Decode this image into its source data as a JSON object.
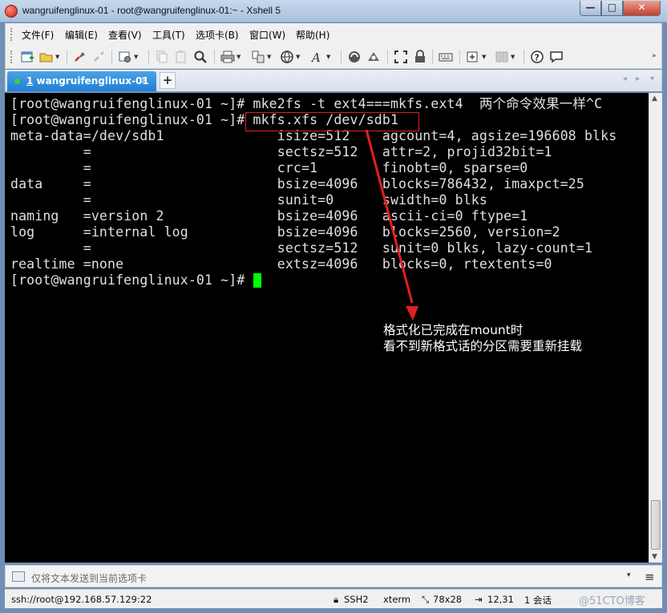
{
  "window": {
    "title": "wangruifenglinux-01 - root@wangruifenglinux-01:~ - Xshell 5",
    "min_glyph": "—",
    "max_glyph": "□",
    "close_glyph": "✕"
  },
  "menu": {
    "items": [
      "文件(F)",
      "编辑(E)",
      "查看(V)",
      "工具(T)",
      "选项卡(B)",
      "窗口(W)",
      "帮助(H)"
    ]
  },
  "tabs": {
    "active": {
      "number": "1",
      "label": "wangruifenglinux-01",
      "close": "×"
    },
    "add": "+",
    "nav_left": "◂",
    "nav_right": "▸",
    "nav_menu": "▾"
  },
  "terminal": {
    "lines": [
      "[root@wangruifenglinux-01 ~]# mke2fs -t ext4===mkfs.ext4  两个命令效果一样^C",
      "[root@wangruifenglinux-01 ~]# mkfs.xfs /dev/sdb1",
      "meta-data=/dev/sdb1              isize=512    agcount=4, agsize=196608 blks",
      "         =                       sectsz=512   attr=2, projid32bit=1",
      "         =                       crc=1        finobt=0, sparse=0",
      "data     =                       bsize=4096   blocks=786432, imaxpct=25",
      "         =                       sunit=0      swidth=0 blks",
      "naming   =version 2              bsize=4096   ascii-ci=0 ftype=1",
      "log      =internal log           bsize=4096   blocks=2560, version=2",
      "         =                       sectsz=512   sunit=0 blks, lazy-count=1",
      "realtime =none                   extsz=4096   blocks=0, rtextents=0",
      "[root@wangruifenglinux-01 ~]# "
    ],
    "annotation": {
      "line1": "格式化已完成在mount时",
      "line2": "看不到新格式话的分区需要重新挂载",
      "color": "#e02020"
    },
    "cursor_color": "#00ff00",
    "background": "#000000"
  },
  "compose": {
    "placeholder": "仅将文本发送到当前选项卡",
    "drop": "▾",
    "menu": "≡"
  },
  "status": {
    "connection": "ssh://root@192.168.57.129:22",
    "protocol": "SSH2",
    "terminal_type": "xterm",
    "size": "78x28",
    "cursor_pos": "12,31",
    "sessions": "1 会话"
  },
  "watermark": "@51CTO博客"
}
